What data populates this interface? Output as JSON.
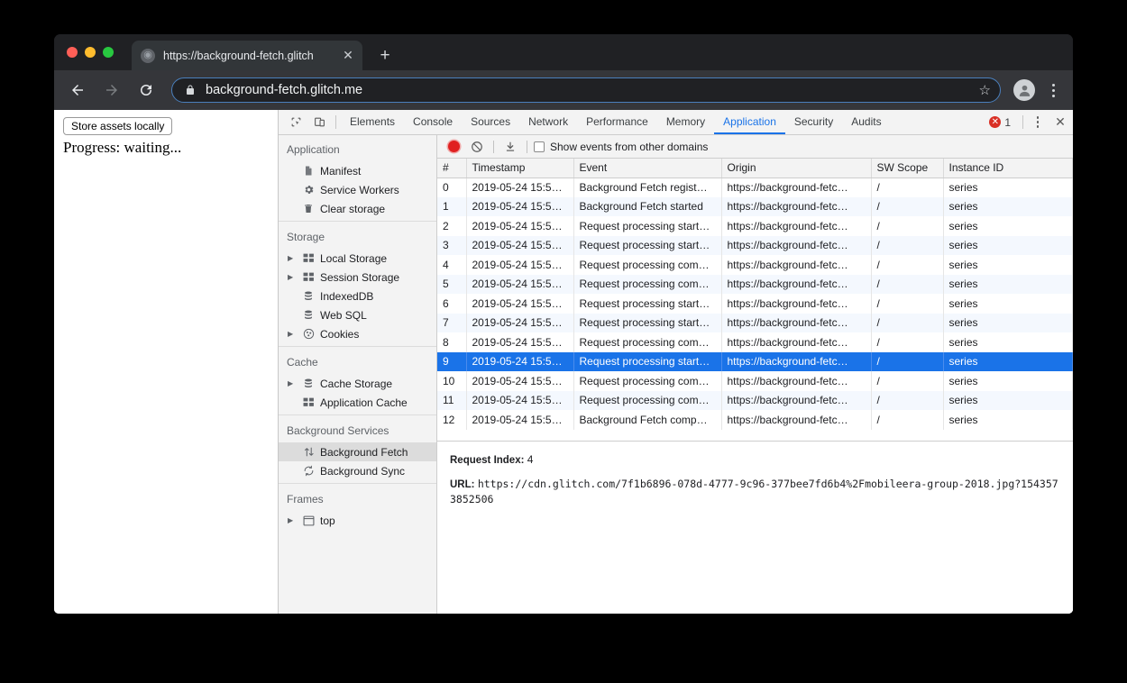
{
  "browser": {
    "tab": {
      "title": "https://background-fetch.glitch",
      "favicon_icon": "globe-icon",
      "close_icon": "close-icon"
    },
    "new_tab_icon": "plus-icon",
    "nav": {
      "back_icon": "arrow-left-icon",
      "forward_icon": "arrow-right-icon",
      "reload_icon": "reload-icon"
    },
    "omnibox": {
      "lock_icon": "lock-icon",
      "url": "background-fetch.glitch.me",
      "star_icon": "star-icon"
    },
    "profile_icon": "avatar-icon",
    "menu_icon": "kebab-menu-icon"
  },
  "page": {
    "store_button": "Store assets locally",
    "progress": "Progress: waiting..."
  },
  "devtools": {
    "inspect_icon": "inspect-element-icon",
    "device_icon": "device-toolbar-icon",
    "tabs": [
      {
        "label": "Elements",
        "active": false
      },
      {
        "label": "Console",
        "active": false
      },
      {
        "label": "Sources",
        "active": false
      },
      {
        "label": "Network",
        "active": false
      },
      {
        "label": "Performance",
        "active": false
      },
      {
        "label": "Memory",
        "active": false
      },
      {
        "label": "Application",
        "active": true
      },
      {
        "label": "Security",
        "active": false
      },
      {
        "label": "Audits",
        "active": false
      }
    ],
    "error_count": "1",
    "error_icon": "error-circle-icon",
    "more_icon": "kebab-menu-icon",
    "close_icon": "close-icon",
    "accent_color": "#1a73e8",
    "error_color": "#d93025",
    "sidebar": [
      {
        "type": "section",
        "title": "Application"
      },
      {
        "type": "item",
        "label": "Manifest",
        "icon": "document-icon",
        "twisty": false,
        "selected": false
      },
      {
        "type": "item",
        "label": "Service Workers",
        "icon": "gear-icon",
        "twisty": false,
        "selected": false
      },
      {
        "type": "item",
        "label": "Clear storage",
        "icon": "trash-icon",
        "twisty": false,
        "selected": false
      },
      {
        "type": "separator"
      },
      {
        "type": "section",
        "title": "Storage"
      },
      {
        "type": "item",
        "label": "Local Storage",
        "icon": "table-icon",
        "twisty": true,
        "selected": false
      },
      {
        "type": "item",
        "label": "Session Storage",
        "icon": "table-icon",
        "twisty": true,
        "selected": false
      },
      {
        "type": "item",
        "label": "IndexedDB",
        "icon": "database-icon",
        "twisty": false,
        "selected": false
      },
      {
        "type": "item",
        "label": "Web SQL",
        "icon": "database-icon",
        "twisty": false,
        "selected": false
      },
      {
        "type": "item",
        "label": "Cookies",
        "icon": "cookie-icon",
        "twisty": true,
        "selected": false
      },
      {
        "type": "separator"
      },
      {
        "type": "section",
        "title": "Cache"
      },
      {
        "type": "item",
        "label": "Cache Storage",
        "icon": "database-icon",
        "twisty": true,
        "selected": false
      },
      {
        "type": "item",
        "label": "Application Cache",
        "icon": "table-icon",
        "twisty": false,
        "selected": false
      },
      {
        "type": "separator"
      },
      {
        "type": "section",
        "title": "Background Services"
      },
      {
        "type": "item",
        "label": "Background Fetch",
        "icon": "up-down-arrows-icon",
        "twisty": false,
        "selected": true
      },
      {
        "type": "item",
        "label": "Background Sync",
        "icon": "sync-refresh-icon",
        "twisty": false,
        "selected": false
      },
      {
        "type": "separator"
      },
      {
        "type": "section",
        "title": "Frames"
      },
      {
        "type": "item",
        "label": "top",
        "icon": "frame-icon",
        "twisty": true,
        "selected": false
      }
    ],
    "record_toolbar": {
      "record_icon": "record-circle-icon",
      "clear_icon": "clear-no-entry-icon",
      "download_icon": "download-arrow-icon",
      "checkbox_label": "Show events from other domains",
      "checkbox_checked": false
    },
    "grid": {
      "columns": [
        "#",
        "Timestamp",
        "Event",
        "Origin",
        "SW Scope",
        "Instance ID"
      ],
      "rows": [
        {
          "idx": "0",
          "timestamp": "2019-05-24 15:5…",
          "event": "Background Fetch regist…",
          "origin": "https://background-fetc…",
          "sw_scope": "/",
          "instance_id": "series",
          "selected": false
        },
        {
          "idx": "1",
          "timestamp": "2019-05-24 15:5…",
          "event": "Background Fetch started",
          "origin": "https://background-fetc…",
          "sw_scope": "/",
          "instance_id": "series",
          "selected": false
        },
        {
          "idx": "2",
          "timestamp": "2019-05-24 15:5…",
          "event": "Request processing start…",
          "origin": "https://background-fetc…",
          "sw_scope": "/",
          "instance_id": "series",
          "selected": false
        },
        {
          "idx": "3",
          "timestamp": "2019-05-24 15:5…",
          "event": "Request processing start…",
          "origin": "https://background-fetc…",
          "sw_scope": "/",
          "instance_id": "series",
          "selected": false
        },
        {
          "idx": "4",
          "timestamp": "2019-05-24 15:5…",
          "event": "Request processing com…",
          "origin": "https://background-fetc…",
          "sw_scope": "/",
          "instance_id": "series",
          "selected": false
        },
        {
          "idx": "5",
          "timestamp": "2019-05-24 15:5…",
          "event": "Request processing com…",
          "origin": "https://background-fetc…",
          "sw_scope": "/",
          "instance_id": "series",
          "selected": false
        },
        {
          "idx": "6",
          "timestamp": "2019-05-24 15:5…",
          "event": "Request processing start…",
          "origin": "https://background-fetc…",
          "sw_scope": "/",
          "instance_id": "series",
          "selected": false
        },
        {
          "idx": "7",
          "timestamp": "2019-05-24 15:5…",
          "event": "Request processing start…",
          "origin": "https://background-fetc…",
          "sw_scope": "/",
          "instance_id": "series",
          "selected": false
        },
        {
          "idx": "8",
          "timestamp": "2019-05-24 15:5…",
          "event": "Request processing com…",
          "origin": "https://background-fetc…",
          "sw_scope": "/",
          "instance_id": "series",
          "selected": false
        },
        {
          "idx": "9",
          "timestamp": "2019-05-24 15:5…",
          "event": "Request processing start…",
          "origin": "https://background-fetc…",
          "sw_scope": "/",
          "instance_id": "series",
          "selected": true
        },
        {
          "idx": "10",
          "timestamp": "2019-05-24 15:5…",
          "event": "Request processing com…",
          "origin": "https://background-fetc…",
          "sw_scope": "/",
          "instance_id": "series",
          "selected": false
        },
        {
          "idx": "11",
          "timestamp": "2019-05-24 15:5…",
          "event": "Request processing com…",
          "origin": "https://background-fetc…",
          "sw_scope": "/",
          "instance_id": "series",
          "selected": false
        },
        {
          "idx": "12",
          "timestamp": "2019-05-24 15:5…",
          "event": "Background Fetch comp…",
          "origin": "https://background-fetc…",
          "sw_scope": "/",
          "instance_id": "series",
          "selected": false
        }
      ]
    },
    "detail": {
      "request_index_key": "Request Index:",
      "request_index_value": "4",
      "url_key": "URL:",
      "url_value": "https://cdn.glitch.com/7f1b6896-078d-4777-9c96-377bee7fd6b4%2Fmobileera-group-2018.jpg?1543573852506"
    }
  }
}
